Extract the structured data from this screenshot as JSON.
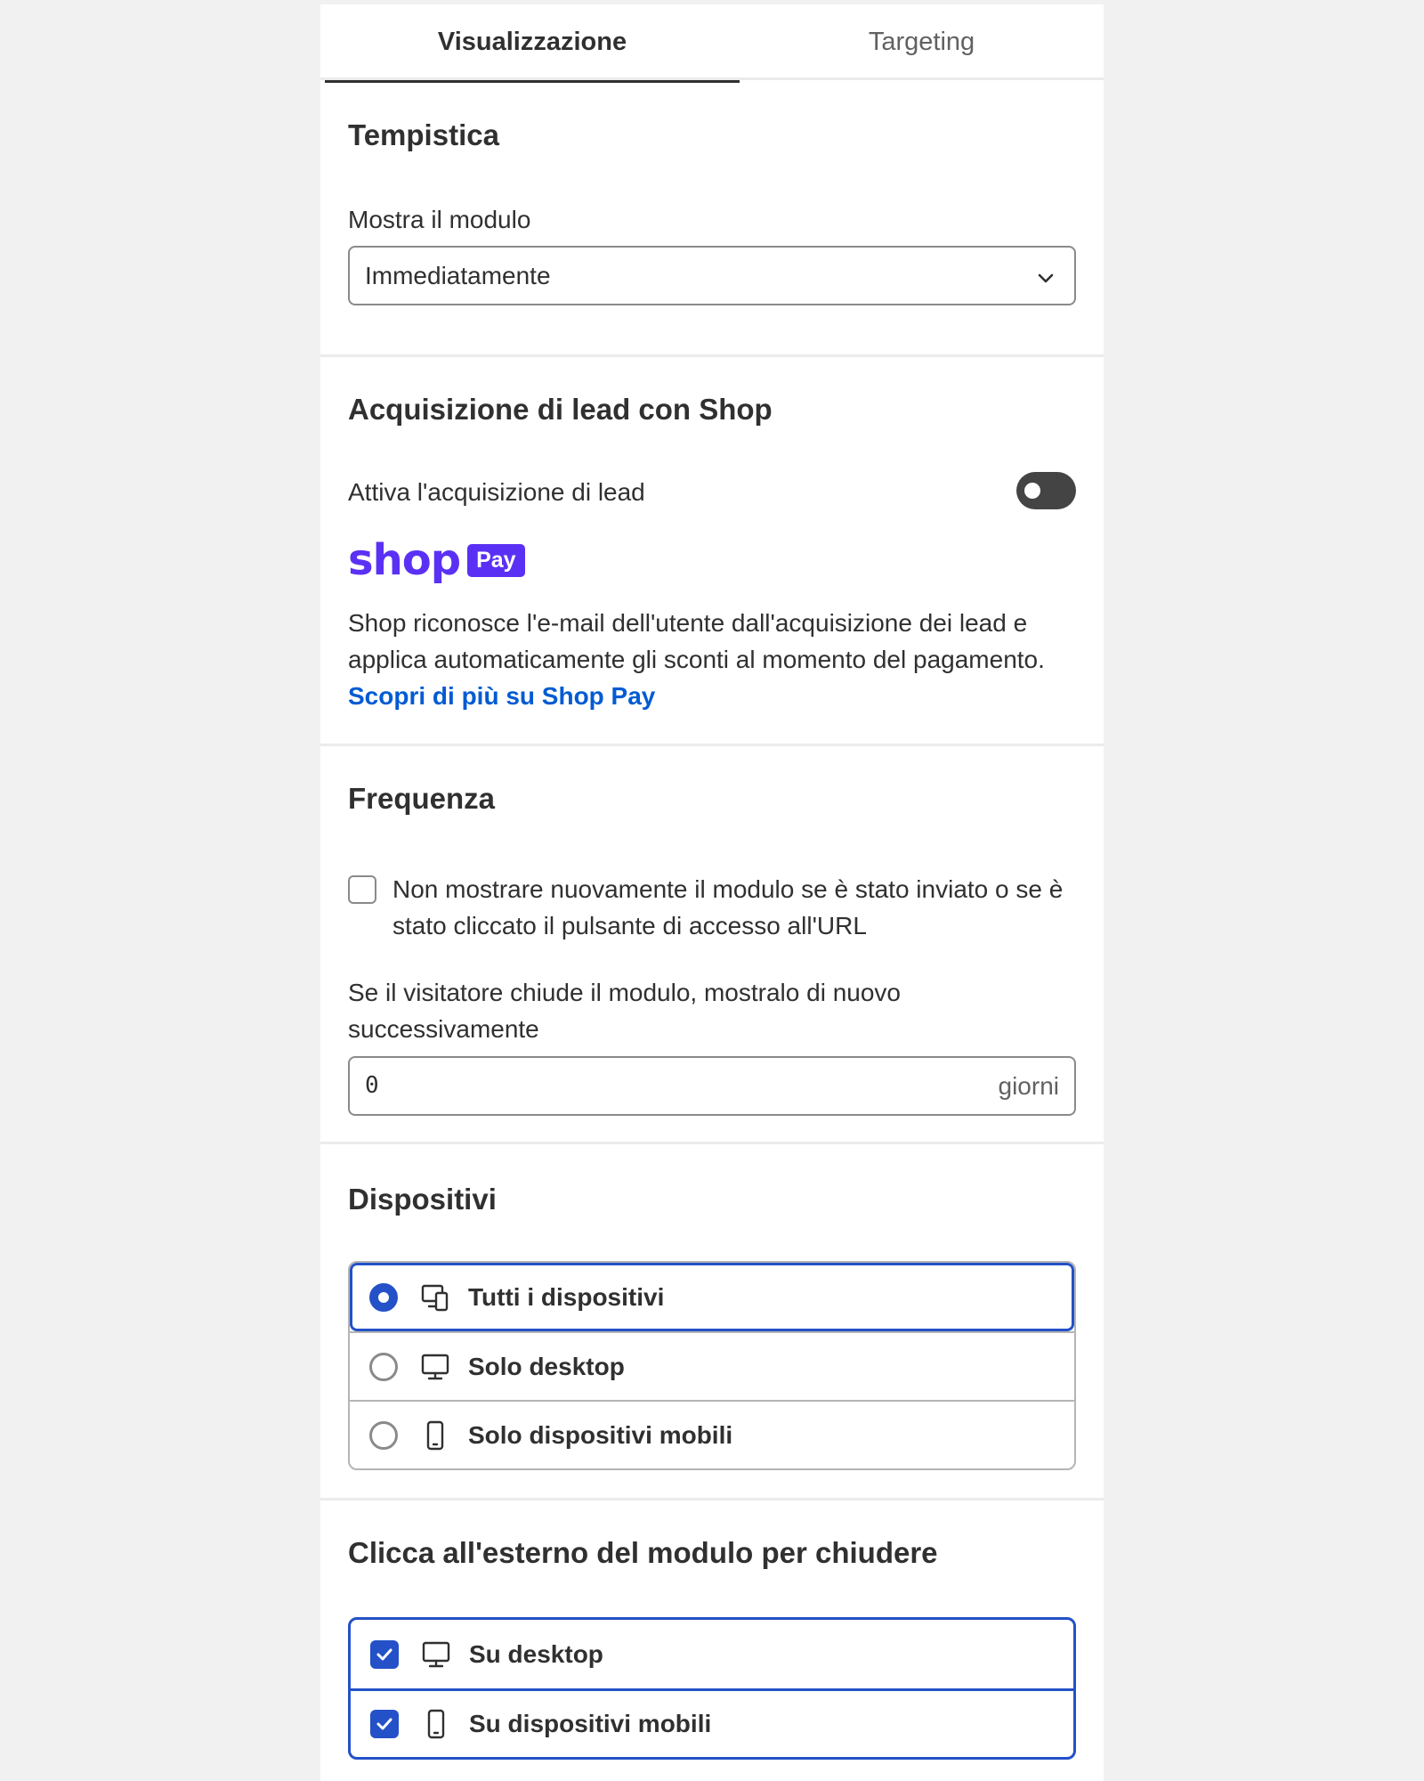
{
  "tabs": {
    "active": "Visualizzazione",
    "inactive": "Targeting"
  },
  "timing": {
    "heading": "Tempistica",
    "show_label": "Mostra il modulo",
    "show_value": "Immediatamente"
  },
  "lead": {
    "heading": "Acquisizione di lead con Shop",
    "toggle_label": "Attiva l'acquisizione di lead",
    "toggle_on": false,
    "logo_word": "shop",
    "logo_badge": "Pay",
    "description": "Shop riconosce l'e-mail dell'utente dall'acquisizione dei lead e applica automaticamente gli sconti al momento del pagamento.",
    "link": "Scopri di più su Shop Pay"
  },
  "frequency": {
    "heading": "Frequenza",
    "checkbox_label": "Non mostrare nuovamente il modulo se è stato inviato o se è stato cliccato il pulsante di accesso all'URL",
    "checkbox_checked": false,
    "reshow_label": "Se il visitatore chiude il modulo, mostralo di nuovo successivamente",
    "days_value": "0",
    "days_suffix": "giorni"
  },
  "devices": {
    "heading": "Dispositivi",
    "options": [
      {
        "label": "Tutti i dispositivi",
        "icon": "all-devices-icon",
        "selected": true
      },
      {
        "label": "Solo desktop",
        "icon": "desktop-icon",
        "selected": false
      },
      {
        "label": "Solo dispositivi mobili",
        "icon": "mobile-icon",
        "selected": false
      }
    ]
  },
  "click_outside": {
    "heading": "Clicca all'esterno del modulo per chiudere",
    "options": [
      {
        "label": "Su desktop",
        "icon": "desktop-icon",
        "checked": true
      },
      {
        "label": "Su dispositivi mobili",
        "icon": "mobile-icon",
        "checked": true
      }
    ]
  },
  "colors": {
    "accent": "#2451c8",
    "shop_purple": "#5a31f4",
    "link": "#005bd3"
  }
}
